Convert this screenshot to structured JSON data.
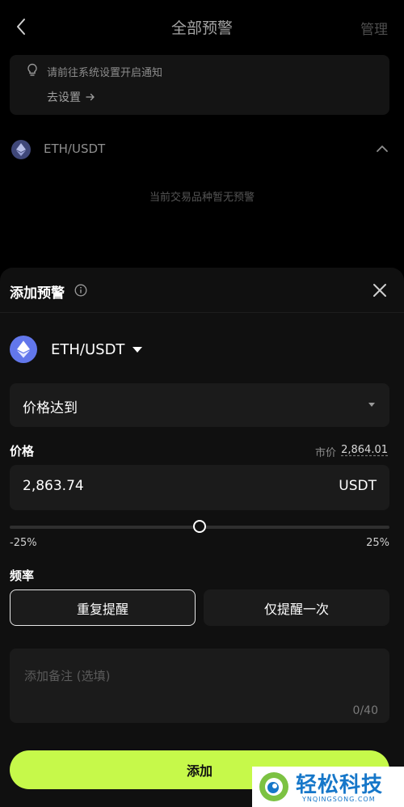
{
  "header": {
    "title": "全部预警",
    "manage_label": "管理"
  },
  "notice": {
    "text": "请前往系统设置开启通知",
    "link_label": "去设置"
  },
  "pair_section": {
    "pair_name": "ETH/USDT",
    "empty_text": "当前交易品种暂无预警"
  },
  "sheet": {
    "title": "添加预警",
    "pair": "ETH/USDT",
    "condition": "价格达到",
    "price": {
      "label": "价格",
      "market_label": "市价",
      "market_value": "2,864.01",
      "value": "2,863.74",
      "unit": "USDT"
    },
    "slider": {
      "min_label": "-25%",
      "max_label": "25%",
      "position_fraction": 0.5
    },
    "frequency": {
      "label": "频率",
      "options": [
        "重复提醒",
        "仅提醒一次"
      ],
      "selected": "重复提醒"
    },
    "note": {
      "placeholder": "添加备注 (选填)",
      "count": "0/40"
    },
    "submit_label": "添加"
  },
  "watermark": {
    "text": "轻松科技",
    "sub": "YNQINGSONG.COM"
  },
  "colors": {
    "accent": "#c6f94a",
    "eth": "#6277eb",
    "background": "#000000",
    "sheet": "#101010",
    "field": "#1b1b1b"
  },
  "icons": [
    "back-chevron-icon",
    "lightbulb-icon",
    "arrow-right-icon",
    "eth-icon",
    "chevron-up-icon",
    "info-icon",
    "close-icon",
    "caret-down-icon"
  ]
}
